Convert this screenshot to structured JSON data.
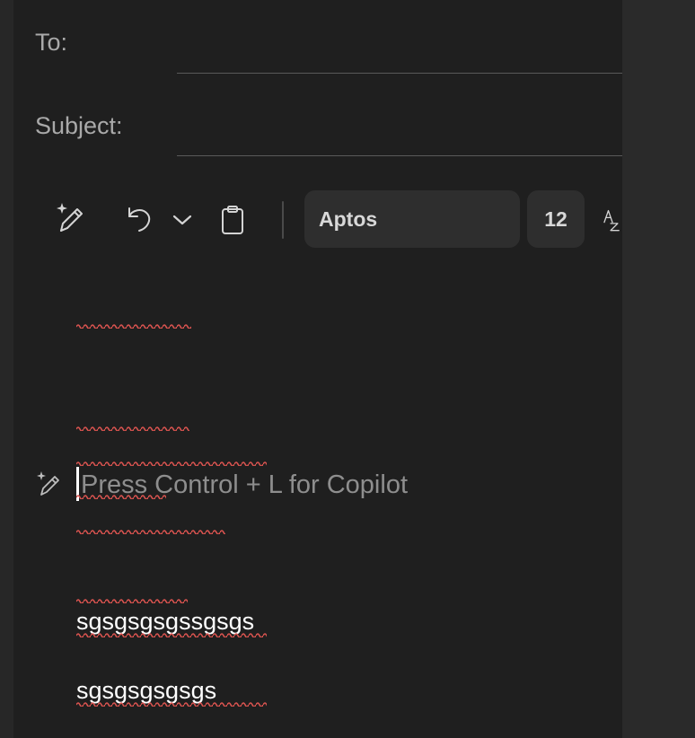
{
  "header": {
    "to_label": "To:",
    "subject_label": "Subject:"
  },
  "toolbar": {
    "font_name": "Aptos",
    "font_size": "12",
    "icons": [
      "copilot-pen-icon",
      "undo-icon",
      "chevron-down-icon",
      "clipboard-icon",
      "text-style-icon"
    ]
  },
  "editor": {
    "placeholder": "Press Control + L for Copilot",
    "lines": [
      "sgsgsgsgssgsgs",
      "sgsgsgsgsgs"
    ]
  },
  "colors": {
    "background": "#1f1f1f",
    "spellcheck": "#d9534f"
  }
}
